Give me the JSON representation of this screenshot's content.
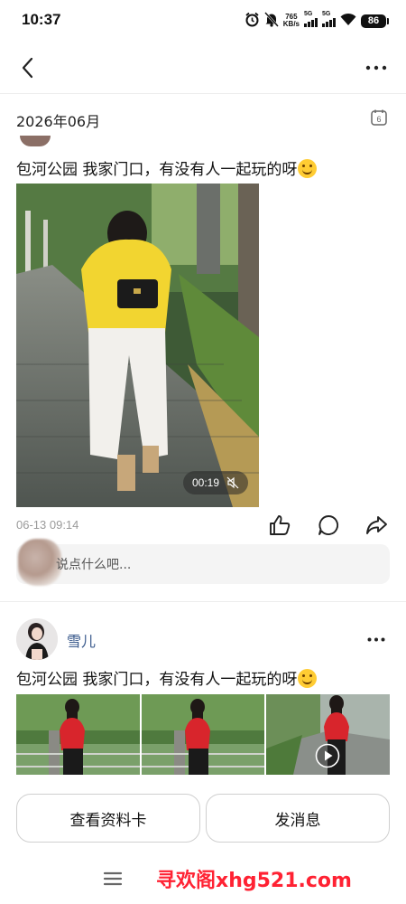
{
  "status_bar": {
    "time": "10:37",
    "net_speed_value": "765",
    "net_speed_unit": "KB/s",
    "sim1_label": "5G",
    "sim2_label": "5G",
    "battery": "86",
    "icons": [
      "alarm-icon",
      "mute-bell-icon",
      "signal-icon",
      "signal-icon",
      "wifi-icon",
      "battery-icon"
    ]
  },
  "nav": {
    "back_icon": "chevron-left-icon",
    "more_icon": "more-dots-icon"
  },
  "date_header": {
    "label": "2026年06月",
    "calendar_day": "6"
  },
  "post1": {
    "text": "包河公园 我家门口，有没有人一起玩的呀",
    "video_duration": "00:19",
    "video_muted": true,
    "time": "06-13 09:14",
    "actions": [
      "like-icon",
      "comment-icon",
      "share-icon"
    ],
    "comment_placeholder": "说点什么吧..."
  },
  "post2": {
    "user_name": "雪儿",
    "text": "包河公园 我家门口，有没有人一起玩的呀",
    "photo_count": 3,
    "third_is_video": true
  },
  "bottom_actions": {
    "profile_button": "查看资料卡",
    "message_button": "发消息"
  },
  "system_nav": {
    "menu_icon": "menu-icon"
  },
  "watermark": "寻欢阁xhg521.com",
  "colors": {
    "username": "#3a5a8c",
    "watermark": "#ff2233",
    "divider": "#ededed"
  }
}
